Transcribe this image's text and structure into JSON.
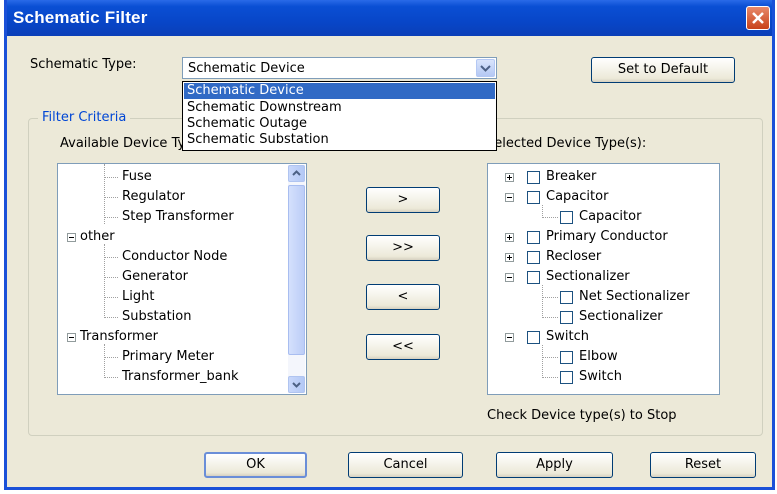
{
  "window": {
    "title": "Schematic Filter"
  },
  "schematic_type": {
    "label": "Schematic Type:",
    "selected": "Schematic Device",
    "options": [
      "Schematic Device",
      "Schematic Downstream",
      "Schematic Outage",
      "Schematic Substation"
    ]
  },
  "set_default_label": "Set to Default",
  "filter_criteria": {
    "legend": "Filter Criteria",
    "available_label": "Available Device Type(s):",
    "selected_label": "Selected Device Type(s):",
    "available_items": [
      "Fuse",
      "Regulator",
      "Step Transformer",
      "other",
      "Conductor Node",
      "Generator",
      "Light",
      "Substation",
      "Transformer",
      "Primary Meter",
      "Transformer_bank"
    ],
    "selected_items": [
      "Breaker",
      "Capacitor",
      "Capacitor",
      "Primary Conductor",
      "Recloser",
      "Sectionalizer",
      "Net Sectionalizer",
      "Sectionalizer",
      "Switch",
      "Elbow",
      "Switch"
    ],
    "move_buttons": [
      ">",
      ">>",
      "<",
      "<<"
    ],
    "footer_note": "Check Device type(s) to Stop"
  },
  "buttons": {
    "ok": "OK",
    "cancel": "Cancel",
    "apply": "Apply",
    "reset": "Reset"
  },
  "colors": {
    "titlebar": "#0846c8",
    "dialog_bg": "#ece9d8",
    "selection": "#316ac5",
    "legend_text": "#0046d5"
  }
}
